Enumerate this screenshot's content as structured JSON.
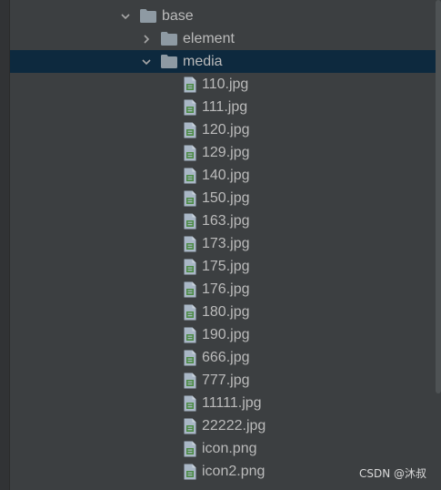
{
  "tree": {
    "base": {
      "label": "base",
      "expanded": true
    },
    "element": {
      "label": "element",
      "expanded": false
    },
    "media": {
      "label": "media",
      "expanded": true,
      "files": [
        "110.jpg",
        "111.jpg",
        "120.jpg",
        "129.jpg",
        "140.jpg",
        "150.jpg",
        "163.jpg",
        "173.jpg",
        "175.jpg",
        "176.jpg",
        "180.jpg",
        "190.jpg",
        "666.jpg",
        "777.jpg",
        "11111.jpg",
        "22222.jpg",
        "icon.png",
        "icon2.png"
      ]
    }
  },
  "watermark": "CSDN @沐叔",
  "colors": {
    "background": "#3c3f41",
    "selection": "#0d293e",
    "text": "#bbbbbb",
    "folder": "#8e9aa3",
    "file_icon_fill": "#a9b7c6",
    "file_icon_accent": "#4b8a44"
  },
  "icons": {
    "expanded": "chevron-down-icon",
    "collapsed": "chevron-right-icon",
    "folder": "folder-icon",
    "file": "image-file-icon"
  }
}
